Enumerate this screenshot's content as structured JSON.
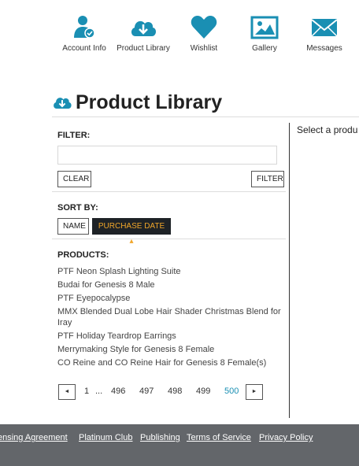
{
  "nav": {
    "items": [
      {
        "label": "Account Info",
        "icon": "account-user-icon"
      },
      {
        "label": "Product Library",
        "icon": "cloud-download-icon"
      },
      {
        "label": "Wishlist",
        "icon": "heart-icon"
      },
      {
        "label": "Gallery",
        "icon": "image-icon"
      },
      {
        "label": "Messages",
        "icon": "envelope-icon"
      }
    ],
    "icon_color": "#1a8fb3"
  },
  "page": {
    "title": "Product Library"
  },
  "filter": {
    "label": "FILTER:",
    "value": "",
    "clear_label": "CLEAR",
    "filter_label": "FILTER"
  },
  "sort": {
    "label": "SORT BY:",
    "name_label": "NAME",
    "date_label": "PURCHASE DATE ▴",
    "active": "PURCHASE DATE"
  },
  "products": {
    "label": "PRODUCTS:",
    "items": [
      "PTF Neon Splash Lighting Suite",
      "Budai for Genesis 8 Male",
      "PTF Eyepocalypse",
      "MMX Blended Dual Lobe Hair Shader Christmas Blend for Iray",
      "PTF Holiday Teardrop Earrings",
      "Merrymaking Style for Genesis 8 Female",
      "CO Reine and CO Reine Hair for Genesis 8 Female(s)"
    ]
  },
  "pagination": {
    "prev": "◄",
    "next": "►",
    "first": "1",
    "ellipsis": "...",
    "pages": [
      "496",
      "497",
      "498",
      "499",
      "500"
    ],
    "current": "500"
  },
  "detail": {
    "message": "Select a produ"
  },
  "footer": {
    "links": [
      "ensing Agreement",
      "Platinum Club",
      "Publishing",
      "Terms of Service",
      "Privacy Policy"
    ]
  }
}
